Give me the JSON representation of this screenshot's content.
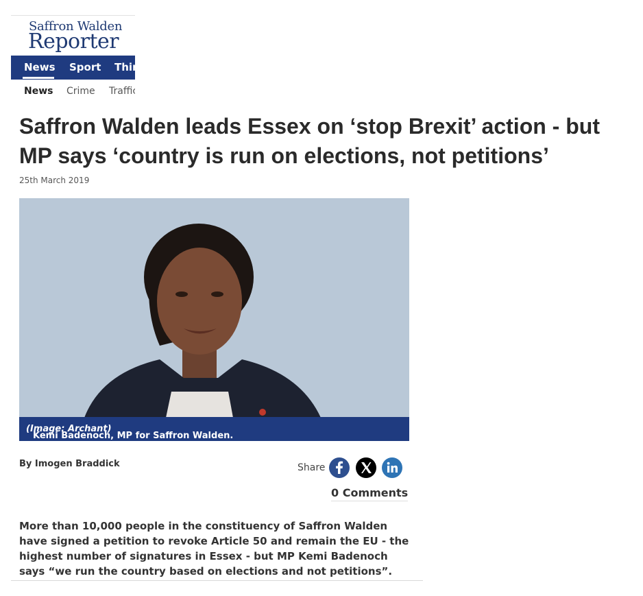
{
  "masthead": {
    "logo_line1": "Saffron Walden",
    "logo_line2": "Reporter"
  },
  "primary_nav": {
    "items": [
      "News",
      "Sport",
      "Thir"
    ]
  },
  "secondary_nav": {
    "items": [
      "News",
      "Crime",
      "Traffic"
    ]
  },
  "article": {
    "headline": "Saffron Walden leads Essex on ‘stop Brexit’ action - but MP says ‘country is run on elections, not petitions’",
    "date": "25th March 2019",
    "caption": "Kemi Badenoch, MP for Saffron Walden.",
    "caption_credit": "(Image: Archant)",
    "byline": "By Imogen Braddick",
    "share_label": "Share",
    "share_icons": [
      "facebook-icon",
      "x-icon",
      "linkedin-icon"
    ],
    "comments": "0 Comments",
    "body": "More than 10,000 people in the constituency of Saffron Walden have signed a petition to revoke Article 50 and remain the EU - the highest number of signatures in Essex - but MP Kemi Badenoch says “we run the country based on elections and not petitions”."
  },
  "colors": {
    "brand_blue": "#1f3b80",
    "facebook": "#2e4f8f",
    "linkedin": "#2e74b5",
    "x": "#000000"
  }
}
